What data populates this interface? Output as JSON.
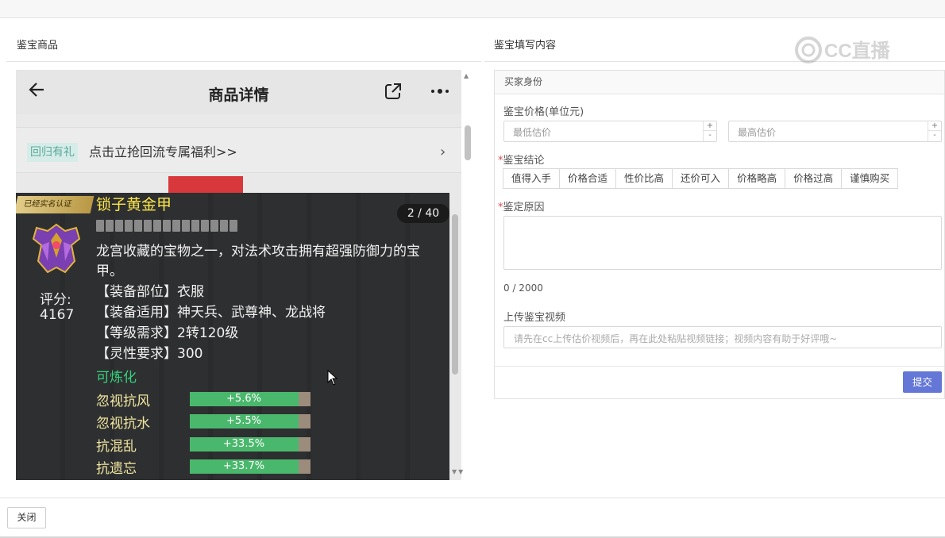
{
  "left_section": {
    "title": "鉴宝商品"
  },
  "right_section": {
    "title": "鉴宝填写内容"
  },
  "watermark": {
    "text": "CC直播"
  },
  "phone": {
    "title": "商品详情",
    "promo_tag": "回归有礼",
    "promo_text": "点击立抢回流专属福利>>",
    "promo_chevron": "›",
    "icons": [
      "back-arrow-icon",
      "share-icon",
      "more-icon"
    ]
  },
  "item": {
    "badge": "已经实名认证",
    "name": "锁子黄金甲",
    "page_counter": "2 / 40",
    "score_label": "评分:",
    "score_value": "4167",
    "description": "龙宫收藏的宝物之一，对法术攻击拥有超强防御力的宝甲。",
    "attrs": [
      "【装备部位】衣服",
      "【装备适用】神天兵、武尊神、龙战将",
      "【等级需求】2转120级",
      "【灵性要求】300"
    ],
    "refinable": "可炼化",
    "stats": [
      {
        "name": "忽视抗风",
        "value": "+5.6%",
        "fill": 0.9
      },
      {
        "name": "忽视抗水",
        "value": "+5.5%",
        "fill": 0.9
      },
      {
        "name": "抗混乱",
        "value": "+33.5%",
        "fill": 0.9
      },
      {
        "name": "抗遗忘",
        "value": "+33.7%",
        "fill": 0.9
      }
    ]
  },
  "form": {
    "panel_header": "买家身份",
    "price_label": "鉴宝价格(单位元)",
    "min_price_placeholder": "最低估价",
    "max_price_placeholder": "最高估价",
    "stepper_up": "+",
    "stepper_down": "-",
    "required_mark": "*",
    "conclusion_label": "鉴宝结论",
    "conclusions": [
      "值得入手",
      "价格合适",
      "性价比高",
      "还价可入",
      "价格略高",
      "价格过高",
      "谨慎购买"
    ],
    "reason_label": "鉴定原因",
    "reason_counter": "0 / 2000",
    "video_label": "上传鉴宝视频",
    "video_placeholder": "请先在cc上传估价视频后，再在此处粘贴视频链接；视频内容有助于好评哦~",
    "submit_label": "提交"
  },
  "footer": {
    "close_label": "关闭"
  },
  "colors": {
    "accent": "#6477d6",
    "item_name": "#ffe84a",
    "refinable": "#35d27b",
    "stat_fill": "#4ab86c",
    "required": "#e24b4b"
  }
}
